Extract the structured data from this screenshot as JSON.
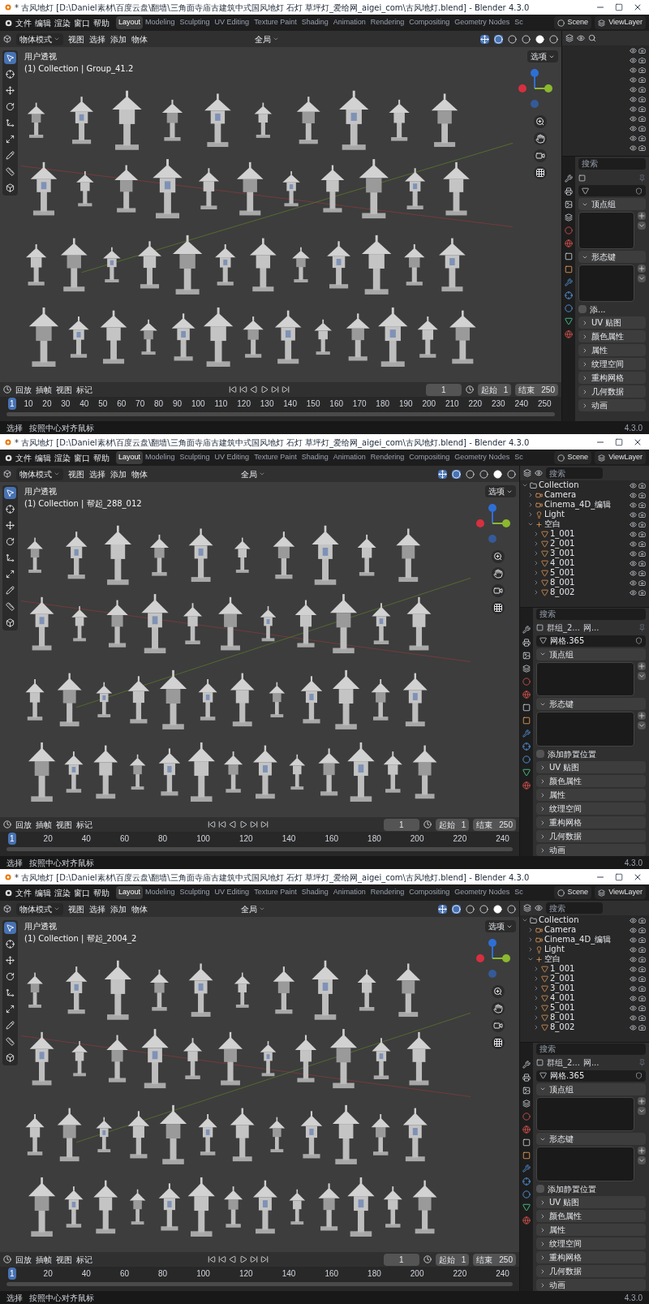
{
  "windows": [
    {
      "title": "* 古风地灯 [D:\\Daniel素材\\百度云盘\\翻墙\\三角面寺庙古建筑中式国风地灯 石灯 草坪灯_爱给网_aigei_com\\古风地灯.blend] - Blender 4.3.0",
      "menu": [
        "文件",
        "编辑",
        "渲染",
        "窗口",
        "帮助"
      ],
      "workspaces": [
        {
          "label": "Layout",
          "selected": true
        },
        {
          "label": "Modeling",
          "selected": false
        },
        {
          "label": "Sculpting",
          "selected": false
        },
        {
          "label": "UV Editing",
          "selected": false
        },
        {
          "label": "Texture Paint",
          "selected": false
        },
        {
          "label": "Shading",
          "selected": false
        },
        {
          "label": "Animation",
          "selected": false
        },
        {
          "label": "Rendering",
          "selected": false
        },
        {
          "label": "Compositing",
          "selected": false
        },
        {
          "label": "Geometry Nodes",
          "selected": false
        },
        {
          "label": "Sc",
          "selected": false
        }
      ],
      "scene": "Scene",
      "view_layer": "ViewLayer",
      "mode": "物体模式",
      "view_menus": [
        "视图",
        "选择",
        "添加",
        "物体"
      ],
      "orientation": "全局",
      "options": "选项",
      "view_name": "用户透视",
      "view_object": "(1) Collection | Group_41.2",
      "properties": {
        "placeholder": "搜索",
        "sections": [
          {
            "label": "顶点组",
            "expanded": true
          },
          {
            "label": "形态键",
            "expanded": true
          },
          {
            "label": "UV 贴图",
            "expanded": false
          },
          {
            "label": "颜色属性",
            "expanded": false
          },
          {
            "label": "属性",
            "expanded": false
          },
          {
            "label": "纹理空间",
            "expanded": false
          },
          {
            "label": "重构网格",
            "expanded": false
          },
          {
            "label": "几何数据",
            "expanded": false
          },
          {
            "label": "动画",
            "expanded": false
          }
        ],
        "rest_position": {
          "label": "添...",
          "checked": false
        }
      },
      "timeline": {
        "menus": [
          "回放",
          "插帧",
          "视图",
          "标记"
        ],
        "frame": "1",
        "start_label": "起始",
        "start": "1",
        "end_label": "结束",
        "end": "250",
        "ticks": [
          {
            "label": "1",
            "selected": true
          },
          {
            "label": "10",
            "selected": false
          },
          {
            "label": "20",
            "selected": false
          },
          {
            "label": "30",
            "selected": false
          },
          {
            "label": "40",
            "selected": false
          },
          {
            "label": "50",
            "selected": false
          },
          {
            "label": "60",
            "selected": false
          },
          {
            "label": "70",
            "selected": false
          },
          {
            "label": "80",
            "selected": false
          },
          {
            "label": "90",
            "selected": false
          },
          {
            "label": "100",
            "selected": false
          },
          {
            "label": "110",
            "selected": false
          },
          {
            "label": "120",
            "selected": false
          },
          {
            "label": "130",
            "selected": false
          },
          {
            "label": "140",
            "selected": false
          },
          {
            "label": "150",
            "selected": false
          },
          {
            "label": "160",
            "selected": false
          },
          {
            "label": "170",
            "selected": false
          },
          {
            "label": "180",
            "selected": false
          },
          {
            "label": "190",
            "selected": false
          },
          {
            "label": "200",
            "selected": false
          },
          {
            "label": "210",
            "selected": false
          },
          {
            "label": "220",
            "selected": false
          },
          {
            "label": "230",
            "selected": false
          },
          {
            "label": "240",
            "selected": false
          },
          {
            "label": "250",
            "selected": false
          }
        ]
      },
      "status": {
        "items": [
          "选择",
          "按照中心对齐鼠标"
        ],
        "version": "4.3.0"
      }
    },
    {
      "title": "* 古风地灯 [D:\\Daniel素材\\百度云盘\\翻墙\\三角面寺庙古建筑中式国风地灯 石灯 草坪灯_爱给网_aigei_com\\古风地灯.blend] - Blender 4.3.0",
      "menu": [
        "文件",
        "编辑",
        "渲染",
        "窗口",
        "帮助"
      ],
      "workspaces": [
        {
          "label": "Layout",
          "selected": true
        },
        {
          "label": "Modeling",
          "selected": false
        },
        {
          "label": "Sculpting",
          "selected": false
        },
        {
          "label": "UV Editing",
          "selected": false
        },
        {
          "label": "Texture Paint",
          "selected": false
        },
        {
          "label": "Shading",
          "selected": false
        },
        {
          "label": "Animation",
          "selected": false
        },
        {
          "label": "Rendering",
          "selected": false
        },
        {
          "label": "Compositing",
          "selected": false
        },
        {
          "label": "Geometry Nodes",
          "selected": false
        },
        {
          "label": "Sc",
          "selected": false
        }
      ],
      "scene": "Scene",
      "view_layer": "ViewLayer",
      "mode": "物体模式",
      "view_menus": [
        "视图",
        "选择",
        "添加",
        "物体"
      ],
      "orientation": "全局",
      "options": "选项",
      "view_name": "用户透视",
      "view_object": "(1) Collection | 帮起_288_012",
      "outliner": {
        "placeholder": "搜索",
        "rows": [
          {
            "name": "Collection",
            "kind": "collection",
            "expanded": true,
            "children": [
              {
                "name": "Camera",
                "kind": "camera",
                "expanded": false
              },
              {
                "name": "Cinema_4D_编辑",
                "kind": "camera",
                "expanded": false
              },
              {
                "name": "Light",
                "kind": "light",
                "expanded": false
              },
              {
                "name": "空白",
                "kind": "empty",
                "expanded": true,
                "children": [
                  {
                    "name": "1_001",
                    "kind": "mesh",
                    "expanded": false
                  },
                  {
                    "name": "2_001",
                    "kind": "mesh",
                    "expanded": false
                  },
                  {
                    "name": "3_001",
                    "kind": "mesh",
                    "expanded": false
                  },
                  {
                    "name": "4_001",
                    "kind": "mesh",
                    "expanded": false
                  },
                  {
                    "name": "5_001",
                    "kind": "mesh",
                    "expanded": false
                  },
                  {
                    "name": "8_001",
                    "kind": "mesh",
                    "expanded": false
                  },
                  {
                    "name": "8_002",
                    "kind": "mesh",
                    "expanded": false
                  }
                ]
              }
            ]
          }
        ]
      },
      "properties": {
        "placeholder": "搜索",
        "breadcrumb": [
          "群组_2...",
          "网..."
        ],
        "mesh_name": "网格.365",
        "sections": [
          {
            "label": "顶点组",
            "expanded": true
          },
          {
            "label": "形态键",
            "expanded": true
          },
          {
            "label": "UV 贴图",
            "expanded": false
          },
          {
            "label": "颜色属性",
            "expanded": false
          },
          {
            "label": "属性",
            "expanded": false
          },
          {
            "label": "纹理空间",
            "expanded": false
          },
          {
            "label": "重构网格",
            "expanded": false
          },
          {
            "label": "几何数据",
            "expanded": false
          },
          {
            "label": "动画",
            "expanded": false
          }
        ],
        "rest_position": {
          "label": "添加静置位置",
          "checked": false
        }
      },
      "timeline": {
        "menus": [
          "回放",
          "插帧",
          "视图",
          "标记"
        ],
        "frame": "1",
        "start_label": "起始",
        "start": "1",
        "end_label": "结束",
        "end": "250",
        "ticks": [
          {
            "label": "1",
            "selected": true
          },
          {
            "label": "20",
            "selected": false
          },
          {
            "label": "40",
            "selected": false
          },
          {
            "label": "60",
            "selected": false
          },
          {
            "label": "80",
            "selected": false
          },
          {
            "label": "100",
            "selected": false
          },
          {
            "label": "120",
            "selected": false
          },
          {
            "label": "140",
            "selected": false
          },
          {
            "label": "160",
            "selected": false
          },
          {
            "label": "180",
            "selected": false
          },
          {
            "label": "200",
            "selected": false
          },
          {
            "label": "220",
            "selected": false
          },
          {
            "label": "240",
            "selected": false
          }
        ]
      },
      "status": {
        "items": [
          "选择",
          "按照中心对齐鼠标"
        ],
        "version": "4.3.0"
      }
    },
    {
      "title": "* 古风地灯 [D:\\Daniel素材\\百度云盘\\翻墙\\三角面寺庙古建筑中式国风地灯 石灯 草坪灯_爱给网_aigei_com\\古风地灯.blend] - Blender 4.3.0",
      "menu": [
        "文件",
        "编辑",
        "渲染",
        "窗口",
        "帮助"
      ],
      "workspaces": [
        {
          "label": "Layout",
          "selected": true
        },
        {
          "label": "Modeling",
          "selected": false
        },
        {
          "label": "Sculpting",
          "selected": false
        },
        {
          "label": "UV Editing",
          "selected": false
        },
        {
          "label": "Texture Paint",
          "selected": false
        },
        {
          "label": "Shading",
          "selected": false
        },
        {
          "label": "Animation",
          "selected": false
        },
        {
          "label": "Rendering",
          "selected": false
        },
        {
          "label": "Compositing",
          "selected": false
        },
        {
          "label": "Geometry Nodes",
          "selected": false
        },
        {
          "label": "Sc",
          "selected": false
        }
      ],
      "scene": "Scene",
      "view_layer": "ViewLayer",
      "mode": "物体模式",
      "view_menus": [
        "视图",
        "选择",
        "添加",
        "物体"
      ],
      "orientation": "全局",
      "options": "选项",
      "view_name": "用户透视",
      "view_object": "(1) Collection | 帮起_2004_2",
      "outliner": {
        "placeholder": "搜索",
        "rows": [
          {
            "name": "Collection",
            "kind": "collection",
            "expanded": true,
            "children": [
              {
                "name": "Camera",
                "kind": "camera",
                "expanded": false
              },
              {
                "name": "Cinema_4D_编辑",
                "kind": "camera",
                "expanded": false
              },
              {
                "name": "Light",
                "kind": "light",
                "expanded": false
              },
              {
                "name": "空白",
                "kind": "empty",
                "expanded": true,
                "children": [
                  {
                    "name": "1_001",
                    "kind": "mesh",
                    "expanded": false
                  },
                  {
                    "name": "2_001",
                    "kind": "mesh",
                    "expanded": false
                  },
                  {
                    "name": "3_001",
                    "kind": "mesh",
                    "expanded": false
                  },
                  {
                    "name": "4_001",
                    "kind": "mesh",
                    "expanded": false
                  },
                  {
                    "name": "5_001",
                    "kind": "mesh",
                    "expanded": false
                  },
                  {
                    "name": "8_001",
                    "kind": "mesh",
                    "expanded": false
                  },
                  {
                    "name": "8_002",
                    "kind": "mesh",
                    "expanded": false
                  }
                ]
              }
            ]
          }
        ]
      },
      "properties": {
        "placeholder": "搜索",
        "breadcrumb": [
          "群组_2...",
          "网..."
        ],
        "mesh_name": "网格.365",
        "sections": [
          {
            "label": "顶点组",
            "expanded": true
          },
          {
            "label": "形态键",
            "expanded": true
          },
          {
            "label": "UV 贴图",
            "expanded": false
          },
          {
            "label": "颜色属性",
            "expanded": false
          },
          {
            "label": "属性",
            "expanded": false
          },
          {
            "label": "纹理空间",
            "expanded": false
          },
          {
            "label": "重构网格",
            "expanded": false
          },
          {
            "label": "几何数据",
            "expanded": false
          },
          {
            "label": "动画",
            "expanded": false
          }
        ],
        "rest_position": {
          "label": "添加静置位置",
          "checked": false
        }
      },
      "timeline": {
        "menus": [
          "回放",
          "插帧",
          "视图",
          "标记"
        ],
        "frame": "1",
        "start_label": "起始",
        "start": "1",
        "end_label": "结束",
        "end": "250",
        "ticks": [
          {
            "label": "1",
            "selected": true
          },
          {
            "label": "20",
            "selected": false
          },
          {
            "label": "40",
            "selected": false
          },
          {
            "label": "60",
            "selected": false
          },
          {
            "label": "80",
            "selected": false
          },
          {
            "label": "100",
            "selected": false
          },
          {
            "label": "120",
            "selected": false
          },
          {
            "label": "140",
            "selected": false
          },
          {
            "label": "160",
            "selected": false
          },
          {
            "label": "180",
            "selected": false
          },
          {
            "label": "200",
            "selected": false
          },
          {
            "label": "220",
            "selected": false
          },
          {
            "label": "240",
            "selected": false
          }
        ]
      },
      "status": {
        "items": [
          "选择",
          "按照中心对齐鼠标"
        ],
        "version": "4.3.0"
      }
    }
  ]
}
